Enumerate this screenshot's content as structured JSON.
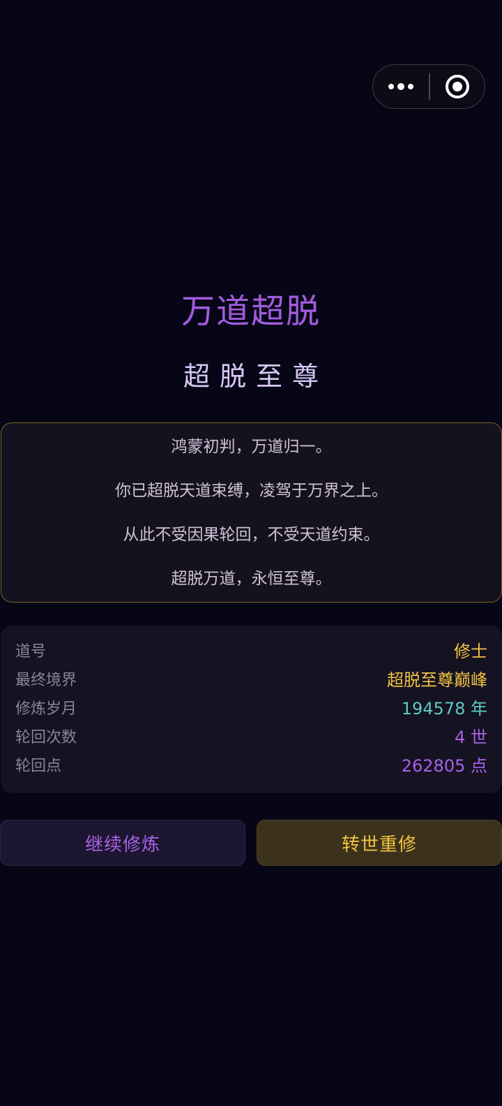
{
  "capsule": {
    "more_icon": "more-dots-icon",
    "close_icon": "target-circle-icon"
  },
  "title": "万道超脱",
  "subtitle": "超脱至尊",
  "story": [
    "鸿蒙初判，万道归一。",
    "你已超脱天道束缚，凌驾于万界之上。",
    "从此不受因果轮回，不受天道约束。",
    "超脱万道，永恒至尊。"
  ],
  "stats": [
    {
      "label": "道号",
      "value": "修士",
      "color": "#f2c440"
    },
    {
      "label": "最终境界",
      "value": "超脱至尊巅峰",
      "color": "#f2c440"
    },
    {
      "label": "修炼岁月",
      "value": "194578 年",
      "color": "#5fc9c2"
    },
    {
      "label": "轮回次数",
      "value": "4 世",
      "color": "#a862e6"
    },
    {
      "label": "轮回点",
      "value": "262805 点",
      "color": "#a862e6"
    }
  ],
  "buttons": {
    "continue_label": "继续修炼",
    "rebirth_label": "转世重修"
  },
  "colors": {
    "background": "#070616",
    "title": "#a25ce0",
    "gold": "#f2c440",
    "teal": "#5fc9c2",
    "purple": "#a862e6"
  }
}
